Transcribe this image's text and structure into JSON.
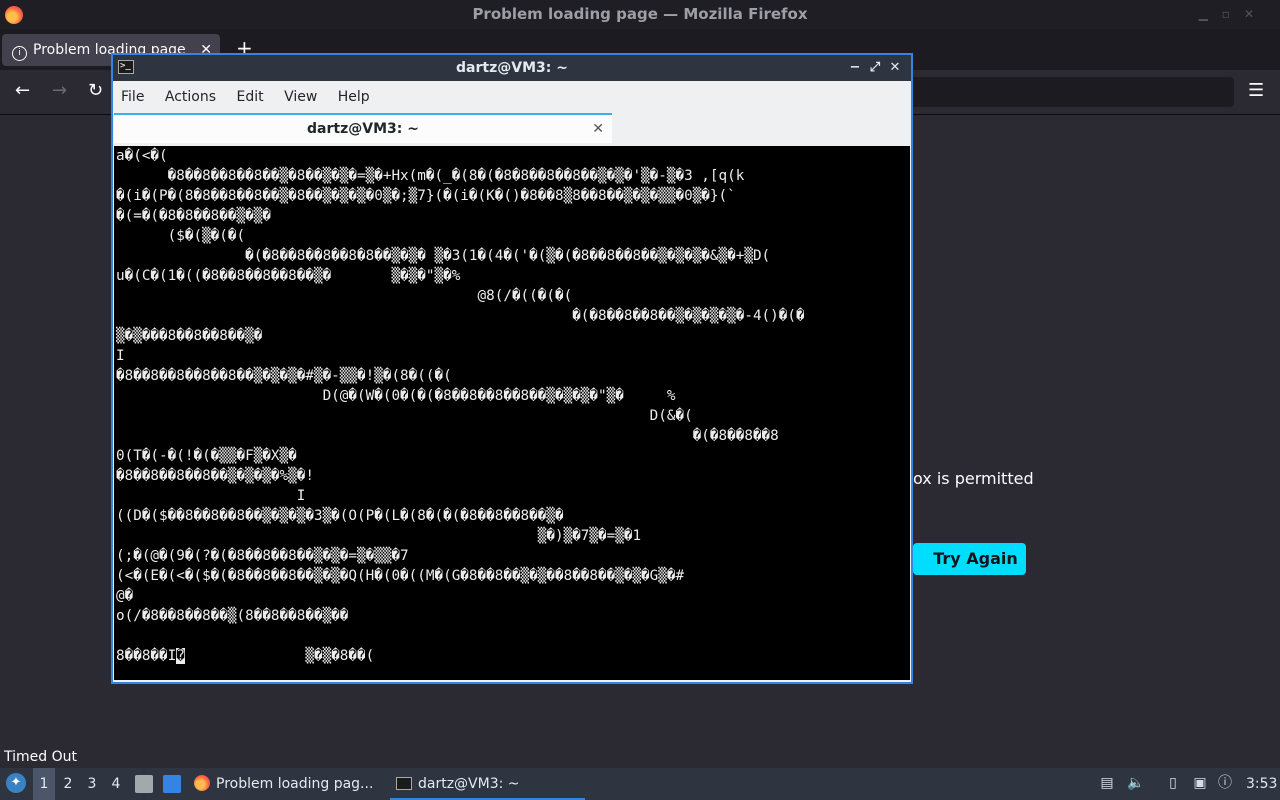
{
  "firefox": {
    "window_title": "Problem loading page — Mozilla Firefox",
    "tab_title": "Problem loading page",
    "content_partial_text": "ox is permitted",
    "try_again_label": "Try Again",
    "status_text": "Timed Out",
    "icons": [
      "firefox-logo",
      "info-icon",
      "close-icon",
      "plus-icon",
      "back-icon",
      "forward-icon",
      "reload-icon",
      "hamburger-menu-icon"
    ]
  },
  "terminal": {
    "window_title": "dartz@VM3: ~",
    "menu": [
      "File",
      "Actions",
      "Edit",
      "View",
      "Help"
    ],
    "tab_title": "dartz@VM3: ~",
    "output": "a�(<�(\n      �8��8��8��8��▒�8��▒�▒�=▒�+Hx(m�(_�(8�(�8�8��8��8��▒�▒�'▒�-▒�3 ,[q(k\n�(i�(P�(8�8��8��8��▒�8��▒�▒�▒�0▒�;▒7}(�(i�(K�()�8��8▒8��8��▒�▒�▒▒�0▒�}(`\n�(=�(�8�8��8��▒�▒�\n      ($�(▒�(�(\n               �(�8��8��8��8�8��▒�▒� ▒�3(1�(4�('�(▒�(�8��8��8��▒�▒�▒�&▒�+▒D(\nu�(C�(1�((�8��8��8��8��▒�       ▒�▒�\"▒�%\n                                          @8(/�((�(�(\n                                                     �(�8��8��8��▒�▒�▒�▒�-4()�(�\n▒�▒���8��8��8��▒�\nI\n�8��8��8��8��8��▒�▒�▒�#▒�-▒▒�!▒�(8�((�(\n                        D(@�(W�(0�(�(�8��8��8��8��▒�▒�▒�\"▒�     %\n                                                              D(&�(\n                                                                   �(�8��8��8\n0(T�(-�(!�(�▒▒�F▒�X▒�\n�8��8��8��8��▒�▒�▒�%▒�!\n                     I\n((D�($��8��8��8��▒�▒�▒�3▒�(O(P�(L�(8�(�(�8��8��8��▒�\n                                                 ▒�)▒�7▒�=▒�1\n(;�(@�(9�(?�(�8��8��8��▒�▒�=▒�▒▒�7\n(<�(E�(<�($�(�8��8��8��▒�▒�Q(H�(0�((M�(G�8��8��▒�▒��8��8��▒�▒�G▒�#\n@�\no(/�8��8��8��▒(8��8��8��▒��\n\n8��8��I",
    "cursor_char": "�",
    "output_tail": "              ▒�▒�8��("
  },
  "taskbar": {
    "workspaces": [
      "1",
      "2",
      "3",
      "4"
    ],
    "active_workspace": "1",
    "tasks": [
      {
        "label": "Problem loading pag...",
        "icon": "firefox-icon"
      },
      {
        "label": "dartz@VM3: ~",
        "icon": "terminal-icon"
      }
    ],
    "clock": "3:53",
    "colors": {
      "accent": "#3584e4",
      "try_again": "#00ddff",
      "panel": "#2e3440"
    }
  }
}
